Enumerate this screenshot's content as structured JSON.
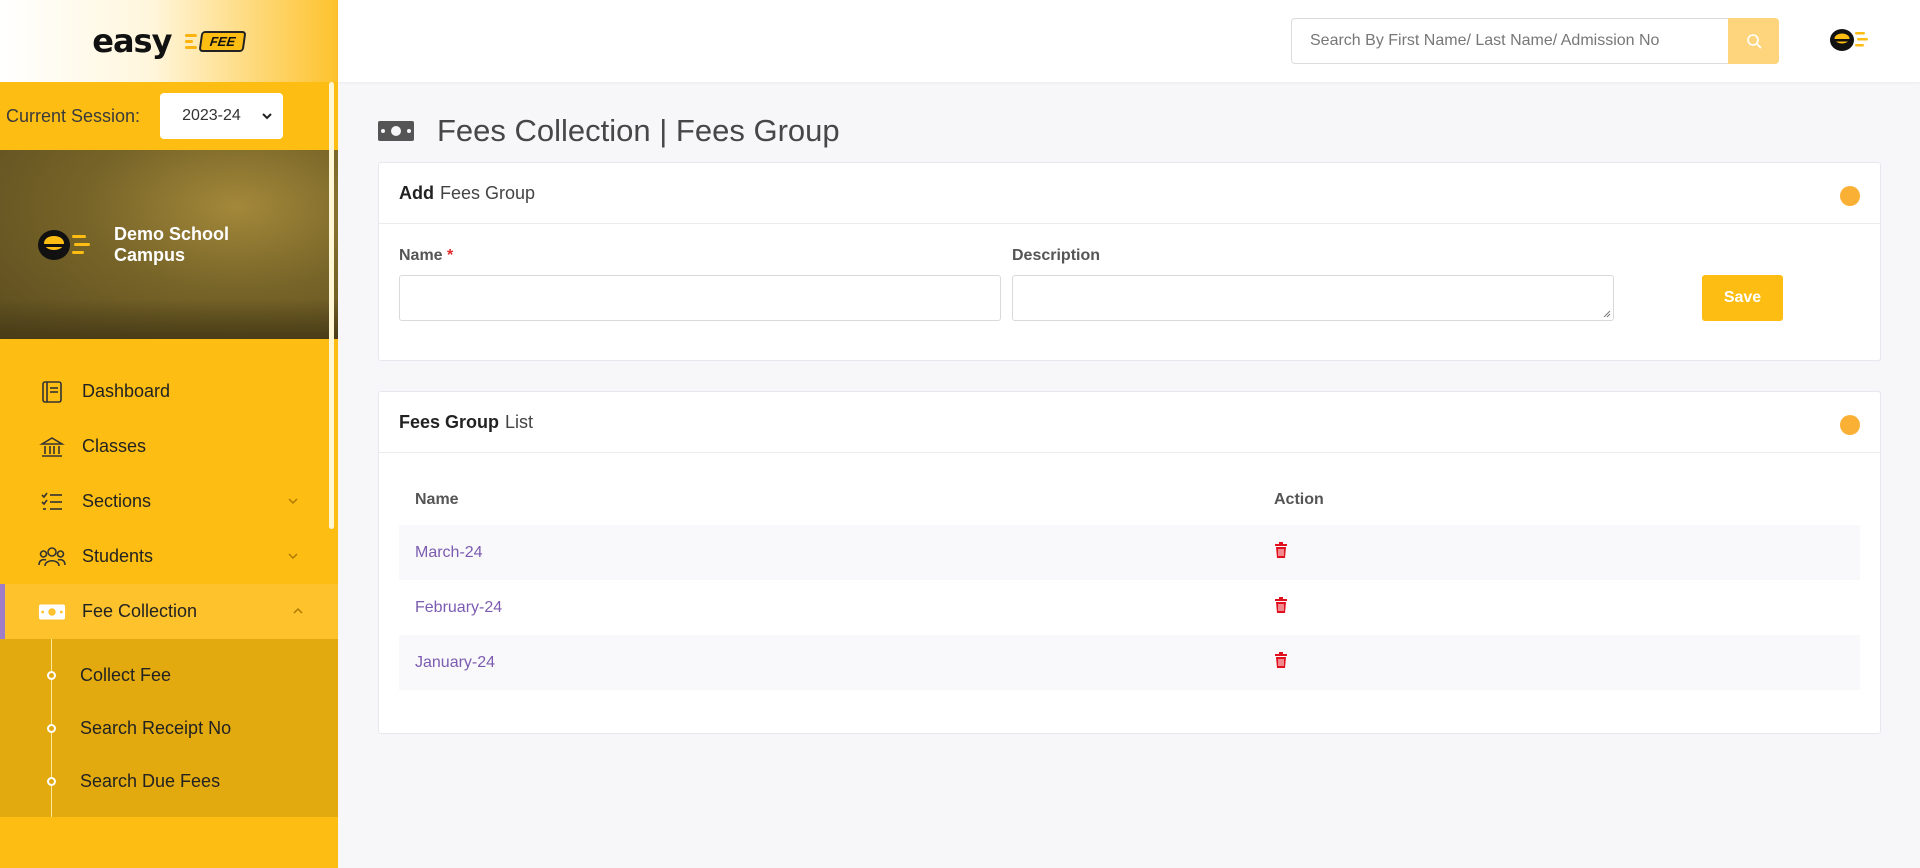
{
  "brand": {
    "logo_text": "easy",
    "logo_badge": "FEE"
  },
  "session": {
    "label": "Current Session:",
    "value": "2023-24"
  },
  "campus": {
    "name": "Demo School Campus"
  },
  "sidebar": {
    "items": [
      {
        "label": "Dashboard",
        "icon": "dashboard-icon"
      },
      {
        "label": "Classes",
        "icon": "classes-icon"
      },
      {
        "label": "Sections",
        "icon": "sections-icon",
        "expandable": true
      },
      {
        "label": "Students",
        "icon": "students-icon",
        "expandable": true
      },
      {
        "label": "Fee Collection",
        "icon": "money-icon",
        "expandable": true,
        "active": true
      }
    ],
    "submenu": [
      {
        "label": "Collect Fee"
      },
      {
        "label": "Search Receipt No"
      },
      {
        "label": "Search Due Fees"
      }
    ]
  },
  "topbar": {
    "search_placeholder": "Search By First Name/ Last Name/ Admission No",
    "search_value": ""
  },
  "page": {
    "title": "Fees Collection | Fees Group"
  },
  "add_form": {
    "header_bold": "Add",
    "header_rest": "Fees Group",
    "name_label": "Name",
    "required_mark": "*",
    "name_value": "",
    "description_label": "Description",
    "description_value": "",
    "save_label": "Save"
  },
  "list": {
    "header_bold": "Fees Group",
    "header_rest": "List",
    "columns": {
      "name": "Name",
      "action": "Action"
    },
    "rows": [
      {
        "name": "March-24"
      },
      {
        "name": "February-24"
      },
      {
        "name": "January-24"
      }
    ]
  },
  "colors": {
    "accent": "#fdbd12",
    "status_dot": "#fab034",
    "link": "#7b5cb0",
    "delete": "#e0101e"
  }
}
